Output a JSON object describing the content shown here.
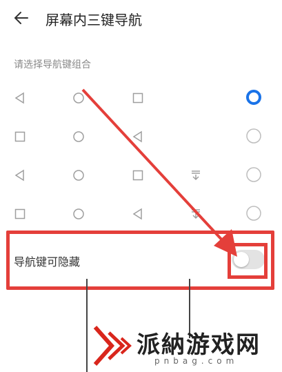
{
  "header": {
    "title": "屏幕内三键导航",
    "back_icon": "back-arrow-icon"
  },
  "section": {
    "subtitle": "请选择导航键组合"
  },
  "combos": [
    {
      "keys": [
        "back-icon",
        "home-icon",
        "recent-icon"
      ],
      "selected": true
    },
    {
      "keys": [
        "recent-icon",
        "home-icon",
        "back-icon"
      ],
      "selected": false
    },
    {
      "keys": [
        "back-icon",
        "home-icon",
        "recent-icon",
        "notification-down-icon"
      ],
      "selected": false
    },
    {
      "keys": [
        "recent-icon",
        "home-icon",
        "back-icon",
        "notification-down-icon"
      ],
      "selected": false
    }
  ],
  "setting": {
    "label": "导航键可隐藏",
    "toggle_on": false
  },
  "colors": {
    "accent": "#1a73e8",
    "highlight": "#e43f3a",
    "icon": "#9e9e9e"
  },
  "watermark": {
    "text": "派納游戏网",
    "url": "pnbag.com"
  }
}
